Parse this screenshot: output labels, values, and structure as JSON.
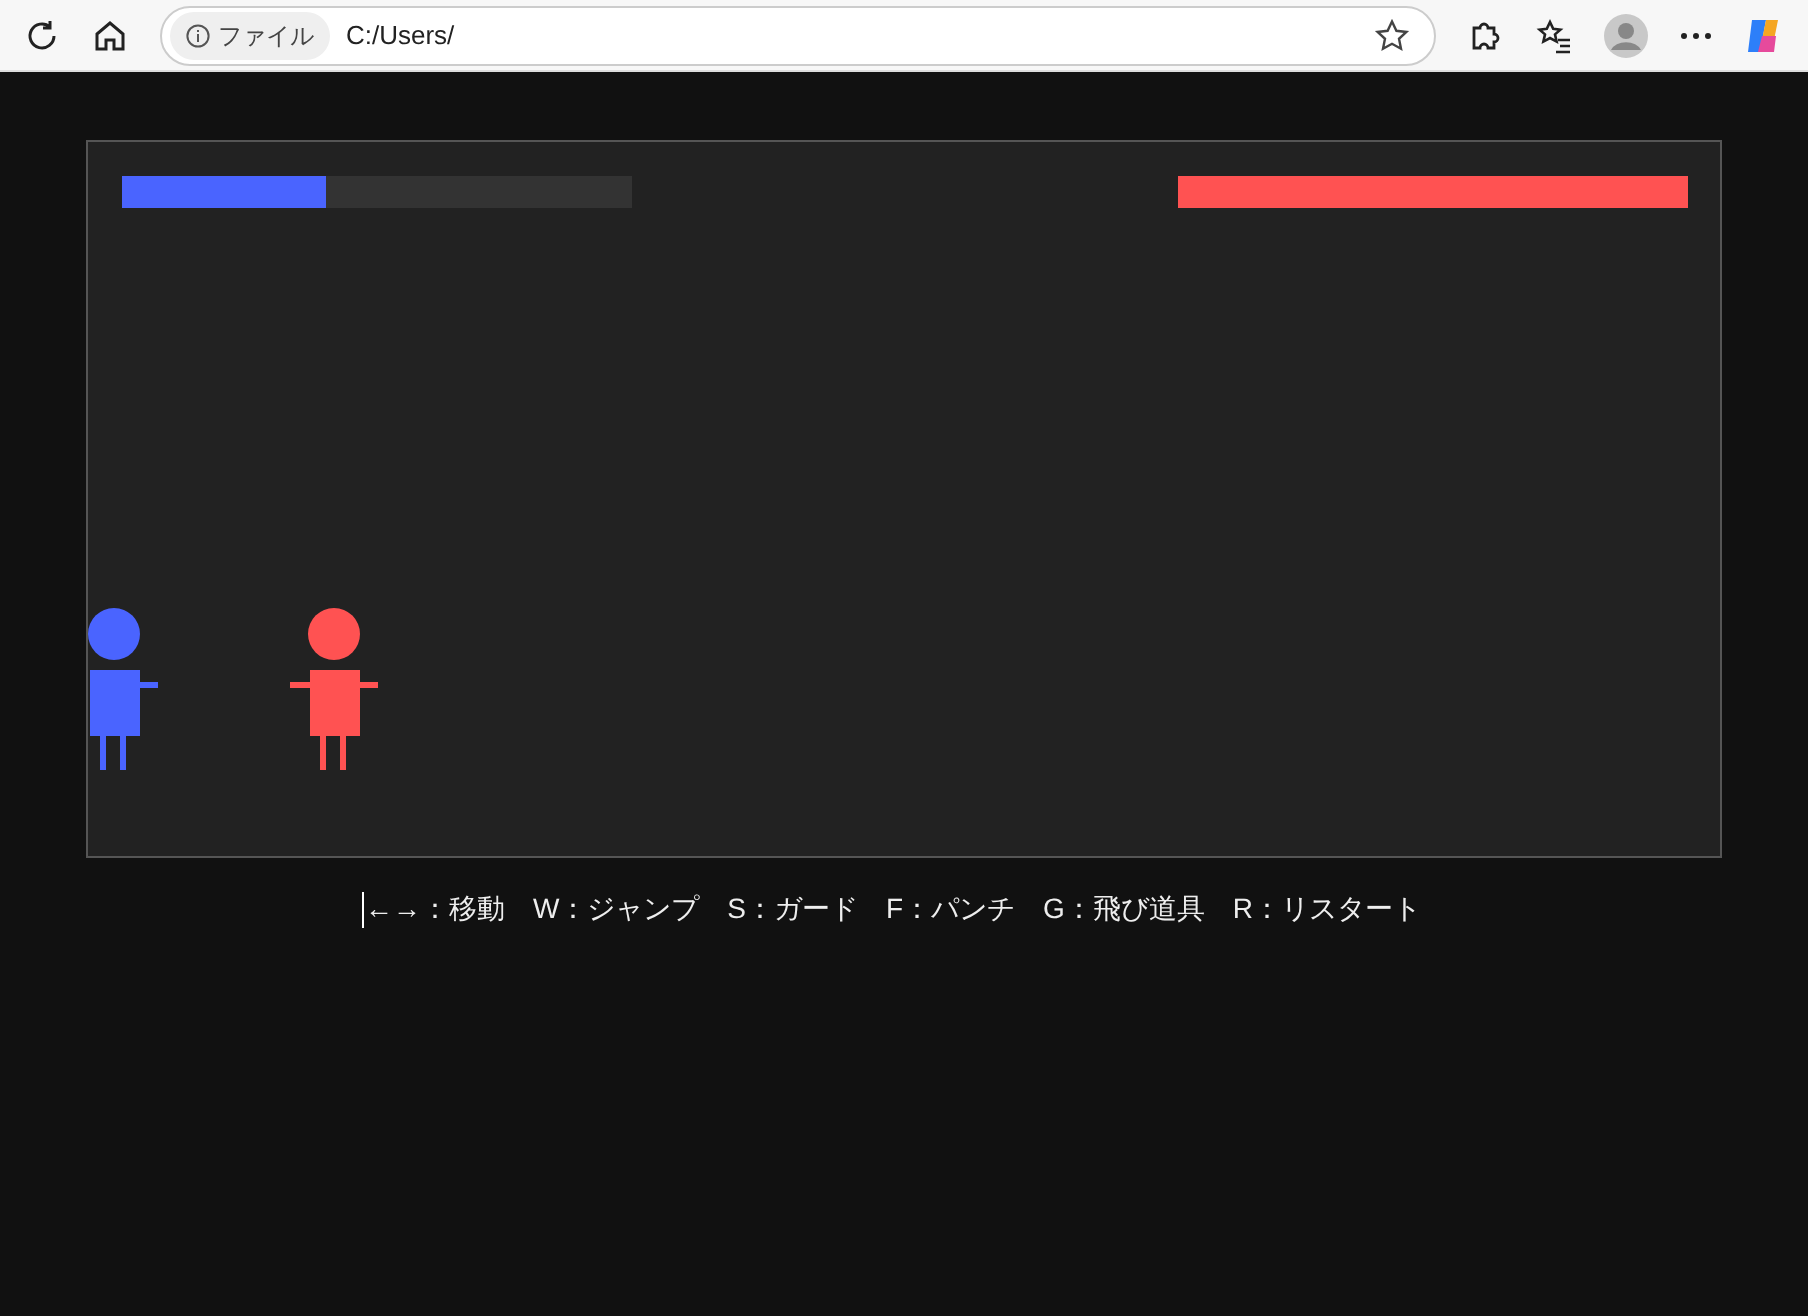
{
  "browser": {
    "address_label": "ファイル",
    "url": "C:/Users/"
  },
  "game": {
    "health_bars": [
      {
        "level": 0.4,
        "color": "#4a64ff"
      },
      {
        "level": 1,
        "color": "#ff5252"
      }
    ],
    "fighters": [
      {
        "kind": "one-arm",
        "color": "#4a64ff"
      },
      {
        "kind": "two-arm",
        "color": "#ff5252"
      }
    ]
  },
  "controls": "←→：移動　W：ジャンプ　S：ガード　F：パンチ　G：飛び道具　R：リスタート"
}
